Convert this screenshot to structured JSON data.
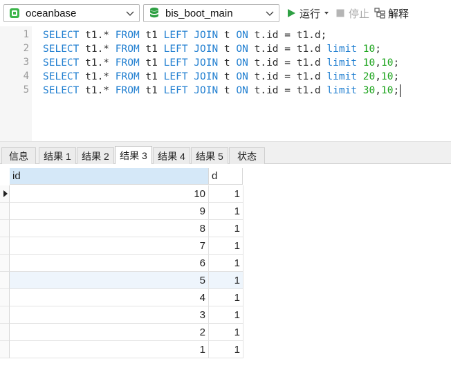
{
  "toolbar": {
    "connection": {
      "value": "oceanbase",
      "icon": "connection-icon"
    },
    "database": {
      "value": "bis_boot_main",
      "icon": "database-icon"
    },
    "run_label": "运行",
    "stop_label": "停止",
    "explain_label": "解释"
  },
  "editor": {
    "line_numbers": [
      "1",
      "2",
      "3",
      "4",
      "5"
    ],
    "lines": [
      [
        [
          "k",
          "SELECT"
        ],
        [
          "t",
          " t1.* "
        ],
        [
          "k",
          "FROM"
        ],
        [
          "t",
          " t1 "
        ],
        [
          "k",
          "LEFT JOIN"
        ],
        [
          "t",
          " t "
        ],
        [
          "k",
          "ON"
        ],
        [
          "t",
          " t.id = t1.d;"
        ]
      ],
      [
        [
          "k",
          "SELECT"
        ],
        [
          "t",
          " t1.* "
        ],
        [
          "k",
          "FROM"
        ],
        [
          "t",
          " t1 "
        ],
        [
          "k",
          "LEFT JOIN"
        ],
        [
          "t",
          " t "
        ],
        [
          "k",
          "ON"
        ],
        [
          "t",
          " t.id = t1.d "
        ],
        [
          "k",
          "limit"
        ],
        [
          "t",
          " "
        ],
        [
          "n",
          "10"
        ],
        [
          "t",
          ";"
        ]
      ],
      [
        [
          "k",
          "SELECT"
        ],
        [
          "t",
          " t1.* "
        ],
        [
          "k",
          "FROM"
        ],
        [
          "t",
          " t1 "
        ],
        [
          "k",
          "LEFT JOIN"
        ],
        [
          "t",
          " t "
        ],
        [
          "k",
          "ON"
        ],
        [
          "t",
          " t.id = t1.d "
        ],
        [
          "k",
          "limit"
        ],
        [
          "t",
          " "
        ],
        [
          "n",
          "10"
        ],
        [
          "t",
          ","
        ],
        [
          "n",
          "10"
        ],
        [
          "t",
          ";"
        ]
      ],
      [
        [
          "k",
          "SELECT"
        ],
        [
          "t",
          " t1.* "
        ],
        [
          "k",
          "FROM"
        ],
        [
          "t",
          " t1 "
        ],
        [
          "k",
          "LEFT JOIN"
        ],
        [
          "t",
          " t "
        ],
        [
          "k",
          "ON"
        ],
        [
          "t",
          " t.id = t1.d "
        ],
        [
          "k",
          "limit"
        ],
        [
          "t",
          " "
        ],
        [
          "n",
          "20"
        ],
        [
          "t",
          ","
        ],
        [
          "n",
          "10"
        ],
        [
          "t",
          ";"
        ]
      ],
      [
        [
          "k",
          "SELECT"
        ],
        [
          "t",
          " t1.* "
        ],
        [
          "k",
          "FROM"
        ],
        [
          "t",
          " t1 "
        ],
        [
          "k",
          "LEFT JOIN"
        ],
        [
          "t",
          " t "
        ],
        [
          "k",
          "ON"
        ],
        [
          "t",
          " t.id = t1.d "
        ],
        [
          "k",
          "limit"
        ],
        [
          "t",
          " "
        ],
        [
          "n",
          "30"
        ],
        [
          "t",
          ","
        ],
        [
          "n",
          "10"
        ],
        [
          "t",
          ";"
        ]
      ]
    ]
  },
  "tabs": [
    "信息",
    "结果 1",
    "结果 2",
    "结果 3",
    "结果 4",
    "结果 5",
    "状态"
  ],
  "active_tab": "结果 3",
  "grid": {
    "columns": [
      "id",
      "d"
    ],
    "rows": [
      [
        "10",
        "1"
      ],
      [
        "9",
        "1"
      ],
      [
        "8",
        "1"
      ],
      [
        "7",
        "1"
      ],
      [
        "6",
        "1"
      ],
      [
        "5",
        "1"
      ],
      [
        "4",
        "1"
      ],
      [
        "3",
        "1"
      ],
      [
        "2",
        "1"
      ],
      [
        "1",
        "1"
      ]
    ],
    "current_row": "10",
    "highlighted_row": "5"
  },
  "colors": {
    "keyword": "#1f7ed0",
    "number": "#1aa31a",
    "run_icon": "#2ea043",
    "database_icon": "#2ea043",
    "connection_icon": "#3bb54a",
    "header_selected": "#d5e8f8"
  }
}
